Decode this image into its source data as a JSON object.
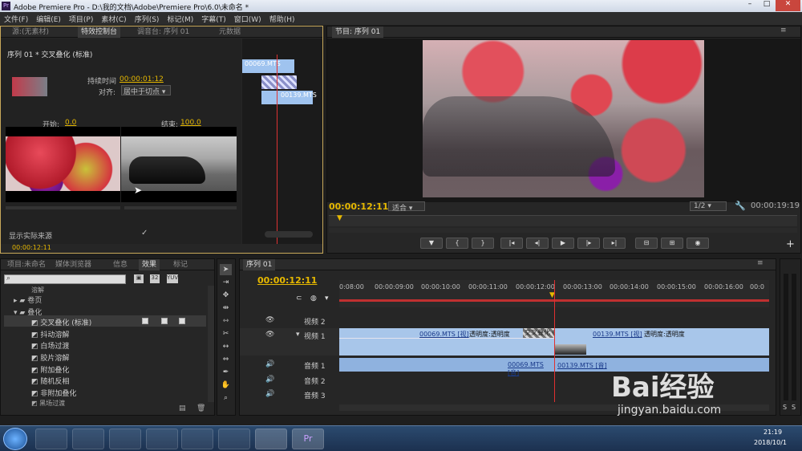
{
  "window": {
    "title": "Adobe Premiere Pro - D:\\我的文档\\Adobe\\Premiere Pro\\6.0\\未命名 *"
  },
  "menu": [
    "文件(F)",
    "编辑(E)",
    "项目(P)",
    "素材(C)",
    "序列(S)",
    "标记(M)",
    "字幕(T)",
    "窗口(W)",
    "帮助(H)"
  ],
  "left_panel": {
    "tabs": [
      "源:(无素材)",
      "特效控制台",
      "调音台: 序列 01",
      "元数据"
    ],
    "header": "序列 01 * 交叉叠化 (标准)",
    "duration_label": "持续时间",
    "duration": "00:00:01:12",
    "align_label": "对齐:",
    "align_value": "居中于切点",
    "start_label": "开始:",
    "start_value": "0.0",
    "end_label": "结束:",
    "end_value": "100.0",
    "show_source": "显示实际来源",
    "clip_a": "00069.MTS",
    "clip_b": "00139.MTS",
    "timecode": "00:00:12:11"
  },
  "program": {
    "tab": "节目: 序列 01",
    "timecode": "00:00:12:11",
    "fit": "适合",
    "quality": "1/2",
    "duration": "00:00:19:19"
  },
  "project_panel": {
    "tabs": [
      "项目:未命名",
      "媒体浏览器",
      "信息",
      "效果",
      "标记"
    ],
    "tree": [
      "卷页",
      "叠化"
    ],
    "items": [
      "交叉叠化 (标准)",
      "抖动溶解",
      "白场过渡",
      "胶片溶解",
      "附加叠化",
      "随机反相",
      "非附加叠化"
    ],
    "top_item": "溶解",
    "cut_item": "黑场过渡"
  },
  "timeline": {
    "tab": "序列 01",
    "timecode": "00:00:12:11",
    "ruler": [
      "0:08:00",
      "00:00:09:00",
      "00:00:10:00",
      "00:00:11:00",
      "00:00:12:00",
      "00:00:13:00",
      "00:00:14:00",
      "00:00:15:00",
      "00:00:16:00",
      "00:0"
    ],
    "tracks": [
      "视频 2",
      "视频 1",
      "音频 1",
      "音频 2",
      "音频 3"
    ],
    "v1_a": "00069.MTS [视]",
    "opacity_a": "透明度:透明度",
    "trans": "交叉叠化 (标准)",
    "v1_b": "00139.MTS [视]",
    "opacity_b": "透明度:透明度",
    "a1_a": "00069.MTS [音]",
    "a1_b": "00139.MTS [音]"
  },
  "taskbar": {
    "time": "21:19",
    "date": "2018/10/1"
  },
  "watermark": {
    "brand": "Bai经验",
    "url": "jingyan.baidu.com"
  }
}
